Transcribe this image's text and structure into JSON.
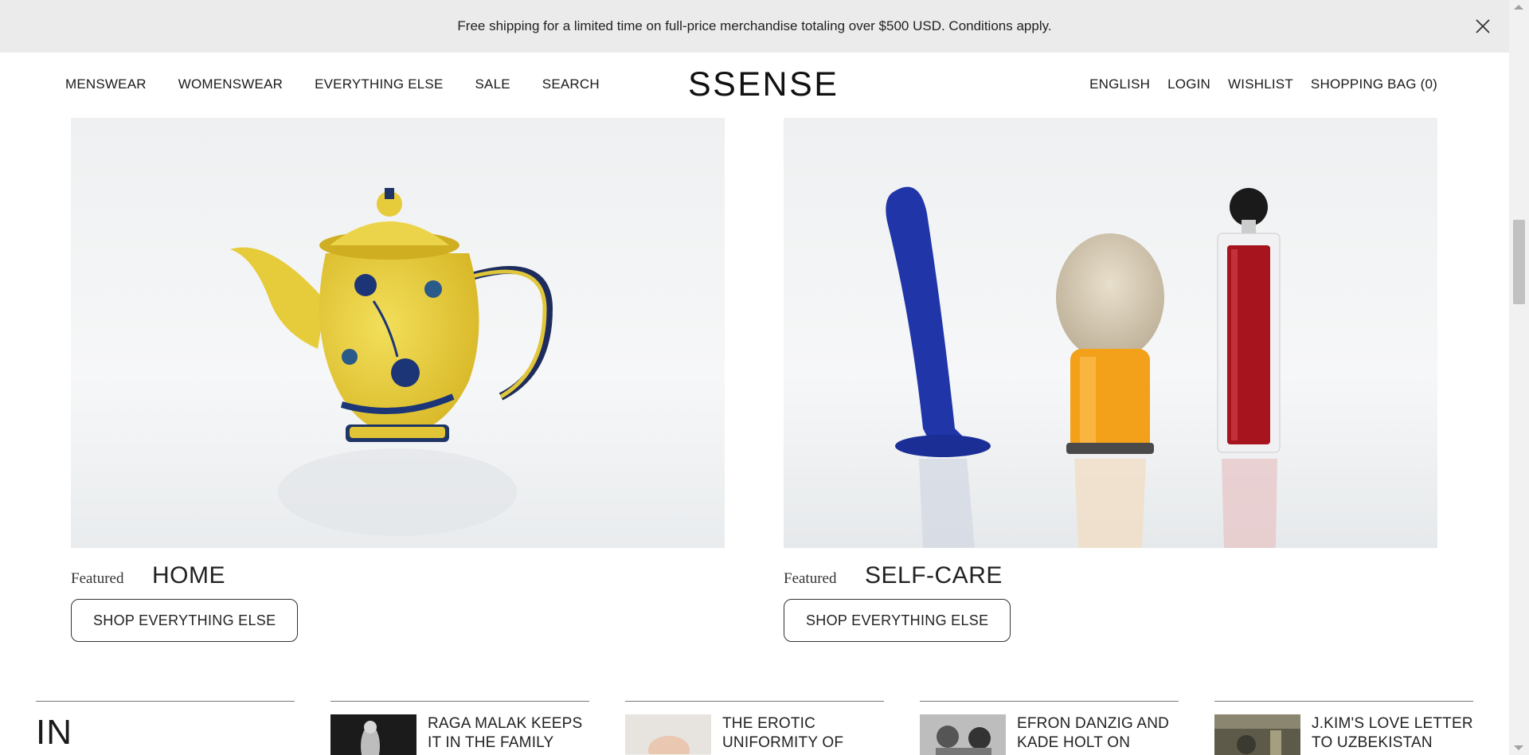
{
  "banner": {
    "text": "Free shipping for a limited time on full-price merchandise totaling over $500 USD. Conditions apply.",
    "close_icon": "close-icon"
  },
  "nav": {
    "left": [
      "MENSWEAR",
      "WOMENSWEAR",
      "EVERYTHING ELSE",
      "SALE",
      "SEARCH"
    ],
    "logo": "SSENSE",
    "right": [
      "ENGLISH",
      "LOGIN",
      "WISHLIST",
      "SHOPPING BAG (0)"
    ]
  },
  "cards": [
    {
      "featured": "Featured",
      "category": "HOME",
      "button": "SHOP EVERYTHING ELSE"
    },
    {
      "featured": "Featured",
      "category": "SELF-CARE",
      "button": "SHOP EVERYTHING ELSE"
    }
  ],
  "stories": {
    "heading": "IN",
    "items": [
      {
        "title": "RAGA MALAK KEEPS IT IN THE FAMILY"
      },
      {
        "title": "THE EROTIC UNIFORMITY OF OLLY"
      },
      {
        "title": "EFRON DANZIG AND KADE HOLT ON"
      },
      {
        "title": "J.KIM'S LOVE LETTER TO UZBEKISTAN"
      }
    ]
  }
}
